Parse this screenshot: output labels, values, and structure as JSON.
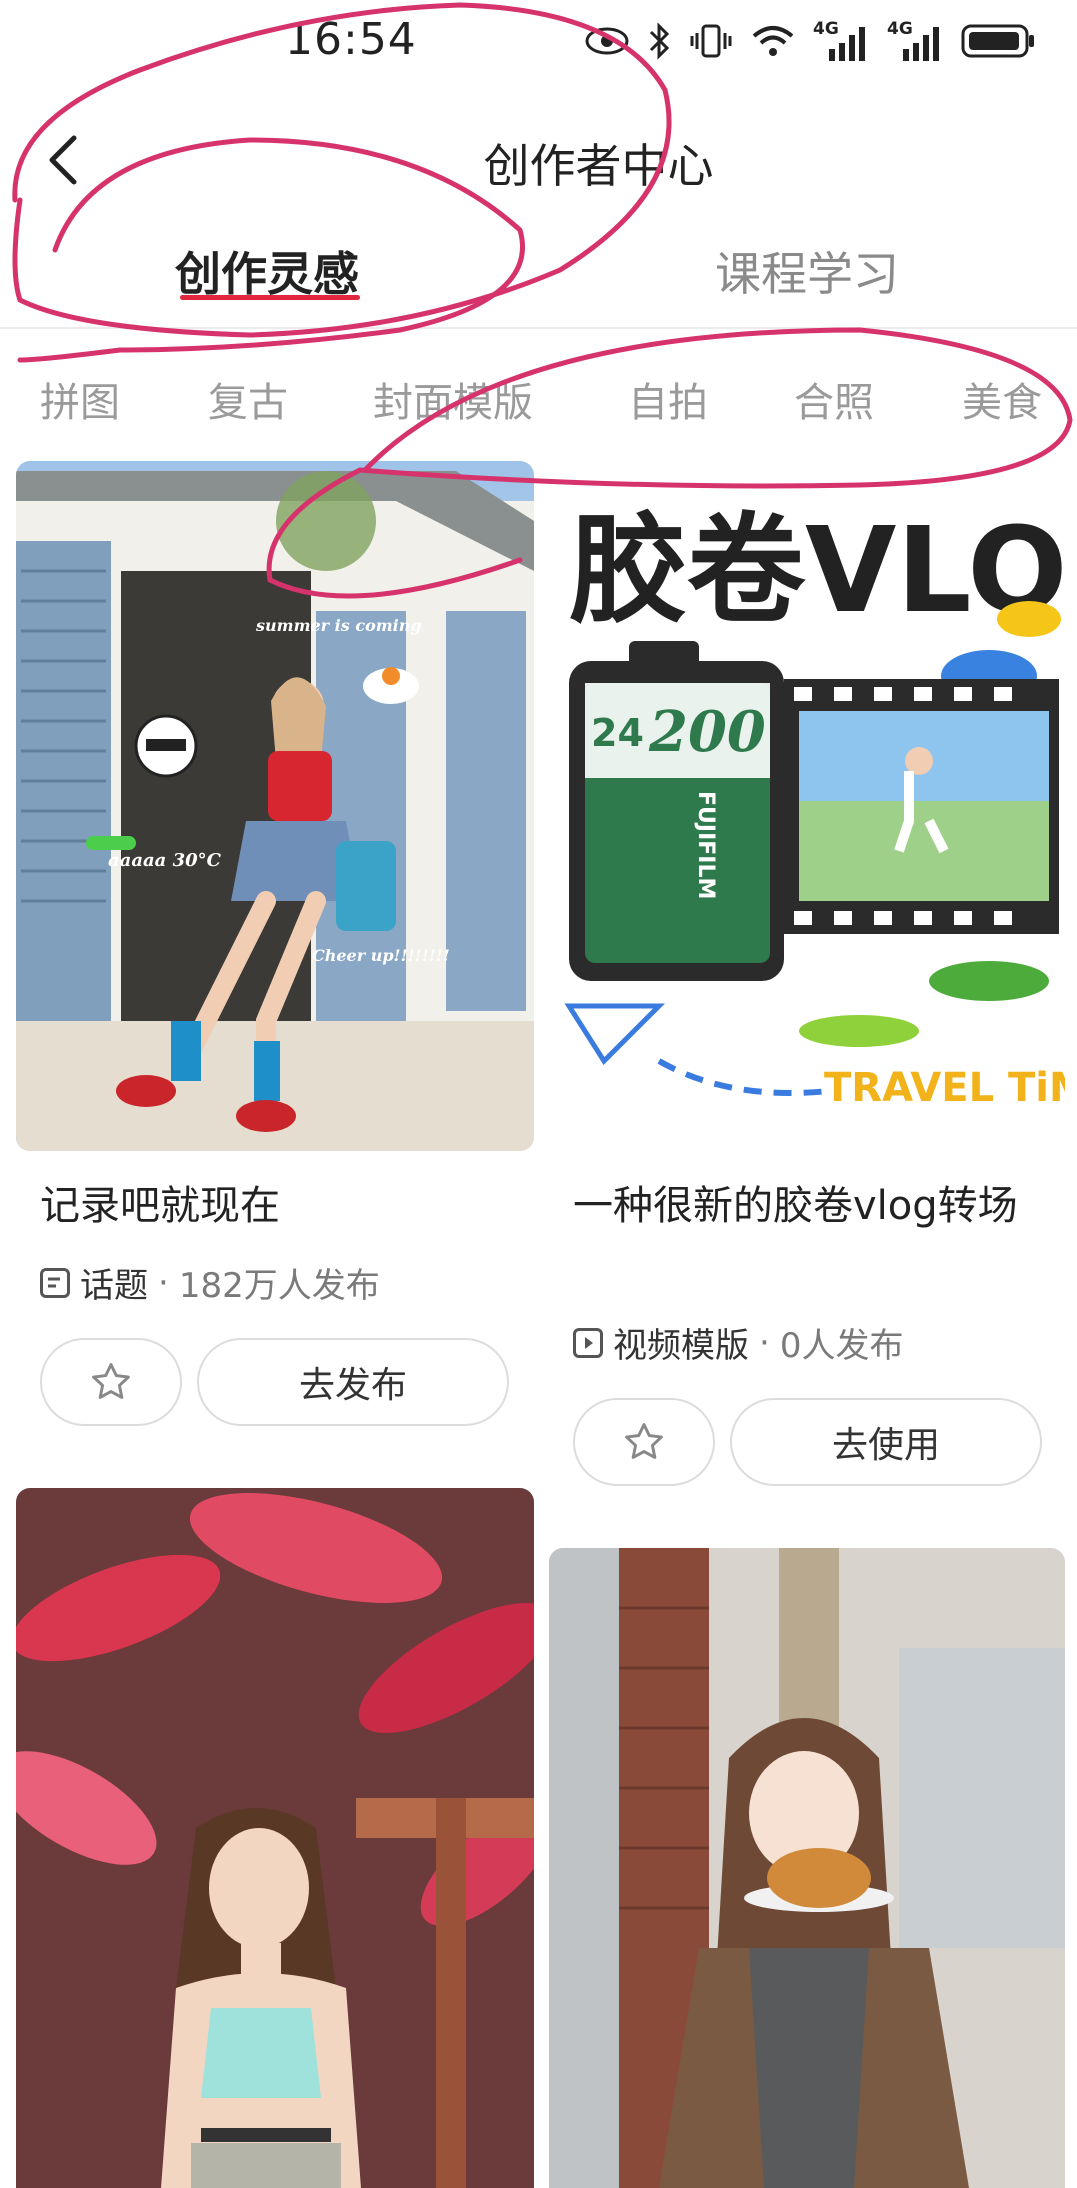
{
  "status_bar": {
    "time": "16:54",
    "icons": [
      "eye-icon",
      "bluetooth-icon",
      "vibrate-icon",
      "wifi-icon",
      "signal-4g-icon",
      "signal-4g-icon",
      "battery-icon"
    ],
    "network_labels": [
      "4G",
      "4G"
    ]
  },
  "header": {
    "title": "创作者中心"
  },
  "tabs": [
    {
      "label": "创作灵感",
      "active": true
    },
    {
      "label": "课程学习",
      "active": false
    }
  ],
  "categories": [
    "拼图",
    "复古",
    "封面模版",
    "自拍",
    "合照",
    "美食"
  ],
  "cards": [
    {
      "title": "记录吧就现在",
      "meta_type": "话题",
      "meta_count": "182万人发布",
      "action_label": "去发布",
      "overlay_texts": [
        "summer is coming",
        "aaaaa 30°C",
        "Cheer up!!!!!!!!"
      ]
    },
    {
      "title": "一种很新的胶卷vlog转场",
      "meta_type": "视频模版",
      "meta_count": "0人发布",
      "action_label": "去使用",
      "overlay_texts": [
        "胶卷VLOG",
        "24",
        "200",
        "FUJIFILM",
        "TRAVEL TiME"
      ]
    }
  ],
  "meta_separator": "·",
  "colors": {
    "accent": "#e0273f",
    "annotation": "#d6336c"
  }
}
